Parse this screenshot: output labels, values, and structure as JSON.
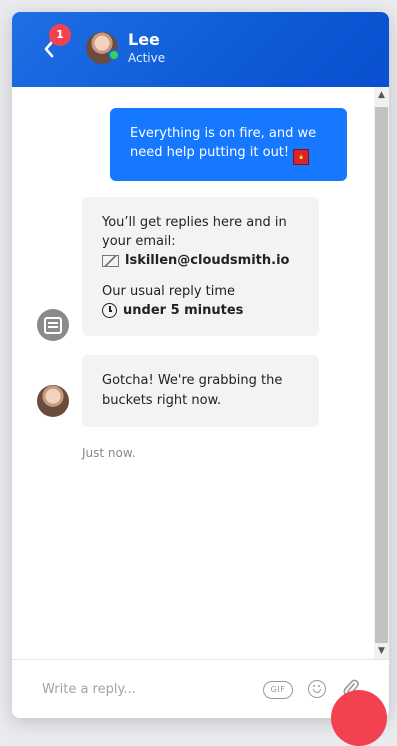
{
  "header": {
    "unread_count": "1",
    "agent_name": "Lee",
    "agent_status": "Active",
    "back_icon": "chevron-left-icon"
  },
  "messages": {
    "user_message": "Everything is on fire, and we need help putting it out!",
    "user_emoji": "fire-emoji",
    "info": {
      "replies_text": "You’ll get replies here and in your email:",
      "email": "lskillen@cloudsmith.io",
      "reply_time_label": "Our usual reply time",
      "reply_time_value": "under 5 minutes"
    },
    "agent_reply": "Gotcha! We're grabbing the buckets right now.",
    "timestamp": "Just now."
  },
  "composer": {
    "placeholder": "Write a reply...",
    "gif_label": "GIF"
  },
  "colors": {
    "header": "#0e5ad7",
    "user_bubble": "#1677ff",
    "badge": "#f2424f",
    "status_online": "#39d353"
  }
}
